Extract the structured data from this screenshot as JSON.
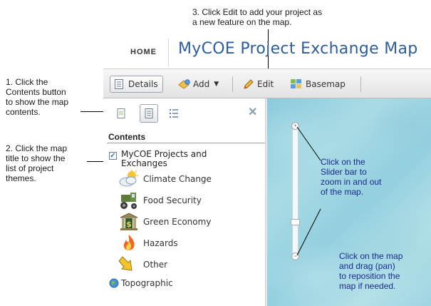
{
  "annotations": {
    "step3": "3. Click Edit to add your project as\na new feature on the map.",
    "step1": "1. Click the\nContents button\nto show the map\ncontents.",
    "step2": "2. Click the map\ntitle to show the\nlist of project\nthemes.",
    "slider_note": "Click on the\nSlider bar to\nzoom in and out\nof the map.",
    "pan_note": "Click on the map\nand drag (pan)\nto reposition the\nmap if needed."
  },
  "header": {
    "home_label": "HOME",
    "title": "MyCOE Project Exchange Map"
  },
  "toolbar": {
    "details_label": "Details",
    "add_label": "Add",
    "edit_label": "Edit",
    "basemap_label": "Basemap"
  },
  "panel": {
    "contents_label": "Contents",
    "layer_title": "MyCOE Projects and Exchanges",
    "themes": [
      {
        "label": "Climate Change",
        "icon": "cloud-sun-icon"
      },
      {
        "label": "Food Security",
        "icon": "tractor-icon"
      },
      {
        "label": "Green Economy",
        "icon": "bank-icon"
      },
      {
        "label": "Hazards",
        "icon": "fire-icon"
      },
      {
        "label": "Other",
        "icon": "arrow-down-icon"
      }
    ],
    "basemap_label": "Topographic"
  },
  "colors": {
    "title_blue": "#2e5d9a",
    "note_blue": "#1a2a8a",
    "map_water": "#9fd5e2"
  }
}
